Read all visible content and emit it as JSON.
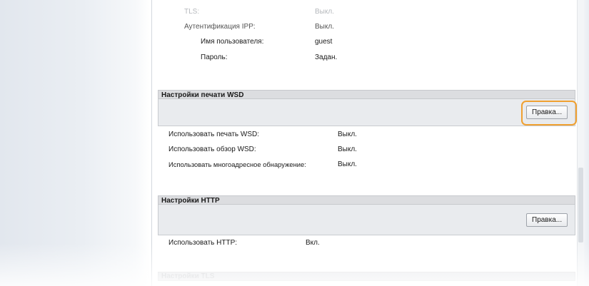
{
  "top_settings": [
    {
      "label": "TLS:",
      "value": "Выкл.",
      "faded": true
    },
    {
      "label": "Аутентификация IPP:",
      "value": "Выкл."
    },
    {
      "label": "Имя пользователя:",
      "value": "guest"
    },
    {
      "label": "Пароль:",
      "value": "Задан."
    }
  ],
  "wsd": {
    "title": "Настройки печати WSD",
    "edit_button": "Правка...",
    "rows": [
      {
        "label": "Использовать печать WSD:",
        "value": "Выкл."
      },
      {
        "label": "Использовать обзор WSD:",
        "value": "Выкл."
      },
      {
        "label": "Использовать многоадресное обнаружение:",
        "value": "Выкл."
      }
    ]
  },
  "http": {
    "title": "Настройки HTTP",
    "edit_button": "Правка...",
    "rows": [
      {
        "label": "Использовать HTTP:",
        "value": "Вкл."
      }
    ]
  },
  "next_section": {
    "title": "Настройки TLS"
  },
  "colors": {
    "highlight": "#f0a030",
    "header_bg": "#dcdde0",
    "bar_bg": "#e9ebee"
  }
}
